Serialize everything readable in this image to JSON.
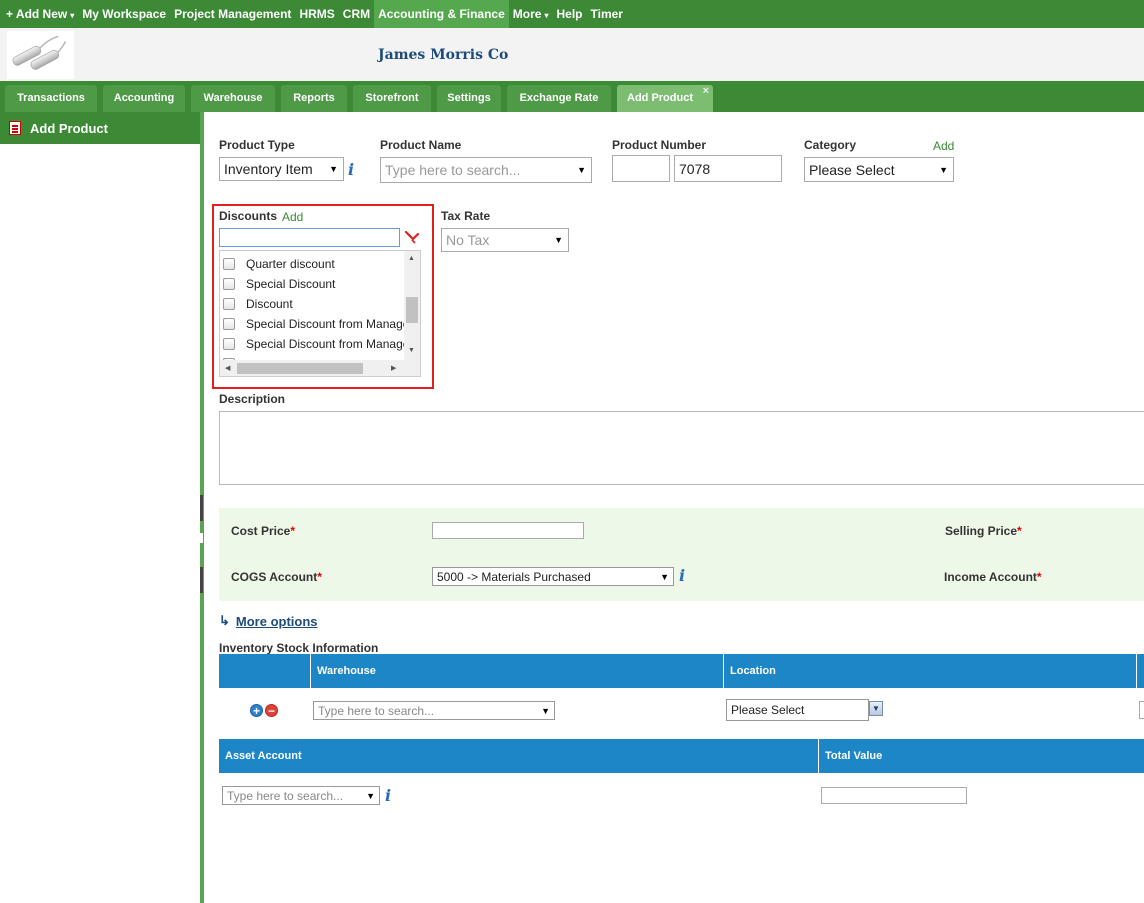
{
  "topnav": {
    "items": [
      "+ Add New",
      "My Workspace",
      "Project Management",
      "HRMS",
      "CRM",
      "Accounting & Finance",
      "More",
      "Help",
      "Timer"
    ],
    "active_index": 5
  },
  "header": {
    "company": "James Morris Co"
  },
  "tabs": [
    "Transactions",
    "Accounting",
    "Warehouse",
    "Reports",
    "Storefront",
    "Settings",
    "Exchange Rate",
    "Add Product"
  ],
  "sidebar": {
    "title": "Add Product"
  },
  "form": {
    "product_type": {
      "label": "Product Type",
      "value": "Inventory Item"
    },
    "product_name": {
      "label": "Product Name",
      "placeholder": "Type here to search..."
    },
    "product_number": {
      "label": "Product Number",
      "prefix": "",
      "value": "7078"
    },
    "category": {
      "label": "Category",
      "add": "Add",
      "value": "Please Select"
    },
    "discounts": {
      "label": "Discounts",
      "add": "Add",
      "filter": "",
      "items": [
        "Quarter discount",
        "Special Discount",
        "Discount",
        "Special Discount from Manage",
        "Special Discount from Manage"
      ]
    },
    "tax_rate": {
      "label": "Tax Rate",
      "value": "No Tax"
    },
    "description": {
      "label": "Description",
      "value": ""
    },
    "cost_price": {
      "label": "Cost Price",
      "value": ""
    },
    "selling_price": {
      "label": "Selling Price"
    },
    "cogs_account": {
      "label": "COGS Account",
      "value": "5000 -> Materials Purchased"
    },
    "income_account": {
      "label": "Income Account"
    },
    "more_options": "More options",
    "more_arrow": "↳",
    "required_mark": "*"
  },
  "inventory": {
    "title": "Inventory Stock Information",
    "headers": [
      "",
      "Warehouse",
      "Location"
    ],
    "row": {
      "warehouse_placeholder": "Type here to search...",
      "location": "Please Select"
    },
    "plus": "+",
    "minus": "−"
  },
  "asset": {
    "headers": [
      "Asset Account",
      "Total Value"
    ],
    "account_placeholder": "Type here to search...",
    "total_value": ""
  },
  "icons": {
    "caret": "▾",
    "select_arrow": "▼",
    "close": "×",
    "info": "i"
  },
  "colors": {
    "brand_green": "#3c8a36",
    "table_blue": "#1d86c6",
    "highlight_red": "#e0201f",
    "pricing_bg": "#eef8e8"
  }
}
